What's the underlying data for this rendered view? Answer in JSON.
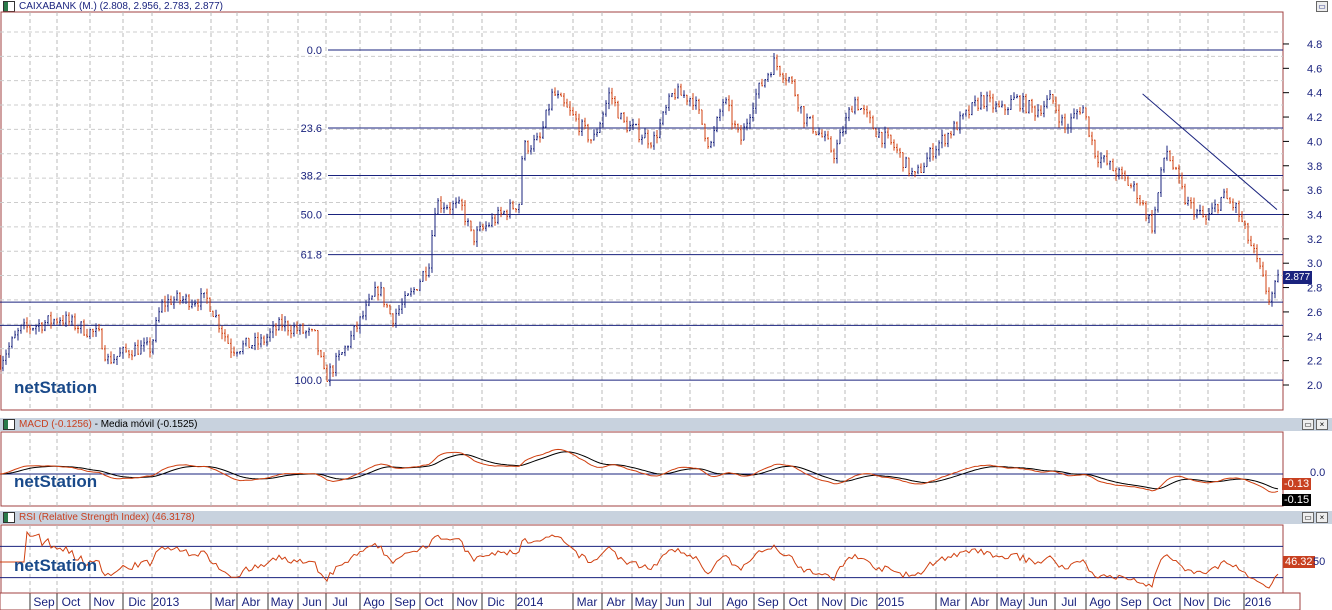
{
  "main": {
    "title": "CAIXABANK (M.) (2.808, 2.956, 2.783, 2.877)",
    "last_price": "2.877",
    "watermark": "netStation"
  },
  "macd": {
    "title": "MACD (-0.1256)",
    "ma_title": "Media móvil (-0.1525)",
    "macd_value": "-0.13",
    "ma_value": "-0.15",
    "zero_label": "0.0"
  },
  "rsi": {
    "title": "RSI (Relative Strength Index) (46.3178)",
    "value": "46.32",
    "mid_label": "50"
  },
  "colors": {
    "up": "#1a237e",
    "down": "#d04010",
    "line": "#1a237e",
    "frame": "#a04040"
  },
  "chart_data": {
    "type": "candlestick",
    "title": "CAIXABANK (M.)",
    "ylim": [
      1.85,
      4.95
    ],
    "yticks": [
      "2.0",
      "2.2",
      "2.4",
      "2.6",
      "2.8",
      "3.0",
      "3.2",
      "3.4",
      "3.6",
      "3.8",
      "4.0",
      "4.2",
      "4.4",
      "4.6",
      "4.8"
    ],
    "xticks": [
      "Sep",
      "Oct",
      "Nov",
      "Dic",
      "2013",
      "Mar",
      "Abr",
      "May",
      "Jun",
      "Jul",
      "Ago",
      "Sep",
      "Oct",
      "Nov",
      "Dic",
      "2014",
      "Mar",
      "Abr",
      "May",
      "Jun",
      "Jul",
      "Ago",
      "Sep",
      "Oct",
      "Nov",
      "Dic",
      "2015",
      "Mar",
      "Abr",
      "May",
      "Jun",
      "Jul",
      "Ago",
      "Sep",
      "Oct",
      "Nov",
      "Dic",
      "2016"
    ],
    "fibonacci": [
      {
        "label": "0.0",
        "price": 4.75
      },
      {
        "label": "23.6",
        "price": 4.11
      },
      {
        "label": "38.2",
        "price": 3.72
      },
      {
        "label": "50.0",
        "price": 3.4
      },
      {
        "label": "61.8",
        "price": 3.07
      },
      {
        "label": "100.0",
        "price": 2.04
      }
    ],
    "support_levels": [
      2.68,
      2.49
    ],
    "trendline": {
      "from": [
        33.6,
        4.39
      ],
      "to": [
        40.0,
        3.44
      ]
    },
    "price_path_t_price": [
      [
        0,
        2.2
      ],
      [
        0.6,
        2.45
      ],
      [
        1.8,
        2.55
      ],
      [
        3,
        2.4
      ],
      [
        3.2,
        2.2
      ],
      [
        4,
        2.3
      ],
      [
        4.5,
        2.3
      ],
      [
        4.8,
        2.65
      ],
      [
        5.1,
        2.7
      ],
      [
        6.2,
        2.7
      ],
      [
        6.9,
        2.3
      ],
      [
        7.8,
        2.35
      ],
      [
        8.4,
        2.5
      ],
      [
        9.4,
        2.4
      ],
      [
        9.7,
        2.05
      ],
      [
        10.2,
        2.25
      ],
      [
        10.8,
        2.55
      ],
      [
        11.3,
        2.8
      ],
      [
        11.7,
        2.55
      ],
      [
        12.3,
        2.75
      ],
      [
        12.8,
        3.0
      ],
      [
        13,
        3.5
      ],
      [
        13.8,
        3.45
      ],
      [
        14.1,
        3.2
      ],
      [
        14.7,
        3.35
      ],
      [
        15.5,
        3.5
      ],
      [
        15.6,
        3.95
      ],
      [
        16.1,
        4.0
      ],
      [
        16.5,
        4.4
      ],
      [
        17.1,
        4.2
      ],
      [
        17.7,
        4.0
      ],
      [
        18.2,
        4.4
      ],
      [
        18.6,
        4.15
      ],
      [
        19.5,
        4.0
      ],
      [
        20.1,
        4.4
      ],
      [
        20.7,
        4.35
      ],
      [
        21.2,
        3.95
      ],
      [
        21.6,
        4.35
      ],
      [
        22.1,
        4.0
      ],
      [
        22.5,
        4.35
      ],
      [
        23.1,
        4.65
      ],
      [
        23.6,
        4.5
      ],
      [
        24,
        4.2
      ],
      [
        24.5,
        4.05
      ],
      [
        24.9,
        3.9
      ],
      [
        25.5,
        4.35
      ],
      [
        26.1,
        4.1
      ],
      [
        26.7,
        3.95
      ],
      [
        27.3,
        3.7
      ],
      [
        27.9,
        3.95
      ],
      [
        28.8,
        4.2
      ],
      [
        29.3,
        4.35
      ],
      [
        29.9,
        4.25
      ],
      [
        30.3,
        4.35
      ],
      [
        30.9,
        4.25
      ],
      [
        31.4,
        4.35
      ],
      [
        31.8,
        4.1
      ],
      [
        32.3,
        4.3
      ],
      [
        32.7,
        3.9
      ],
      [
        33.3,
        3.75
      ],
      [
        33.9,
        3.6
      ],
      [
        34.4,
        3.3
      ],
      [
        34.8,
        3.95
      ],
      [
        35.4,
        3.5
      ],
      [
        36,
        3.35
      ],
      [
        36.5,
        3.55
      ],
      [
        36.9,
        3.45
      ],
      [
        37.4,
        3.1
      ],
      [
        37.9,
        2.7
      ],
      [
        38.2,
        2.88
      ]
    ],
    "macd": {
      "last": -0.1256,
      "ma_last": -0.1525
    },
    "rsi": {
      "last": 46.3178,
      "levels": [
        70,
        30
      ]
    }
  }
}
